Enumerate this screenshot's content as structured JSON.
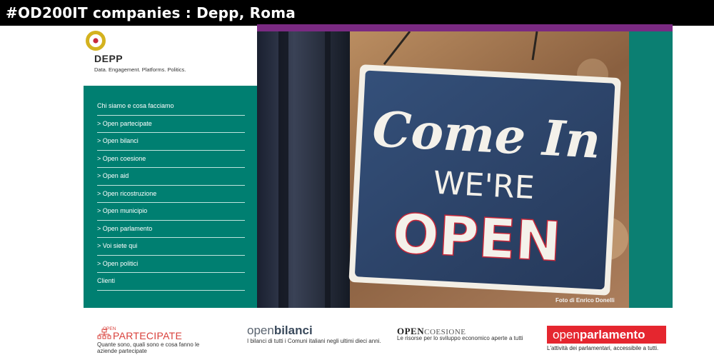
{
  "slide": {
    "title": "#OD200IT companies : Depp, Roma"
  },
  "brand": {
    "name": "DEPP",
    "tagline": "Data. Engagement. Platforms. Politics.",
    "logo_icon": "target-ring-icon",
    "colors": {
      "ring": "#d4b21f",
      "dot": "#c8283a",
      "teal": "#007f71",
      "purple": "#7a2a82"
    }
  },
  "menu": {
    "items": [
      {
        "label": "Chi siamo e cosa facciamo"
      },
      {
        "label": "> Open partecipate"
      },
      {
        "label": "> Open bilanci"
      },
      {
        "label": "> Open coesione"
      },
      {
        "label": "> Open aid"
      },
      {
        "label": "> Open ricostruzione"
      },
      {
        "label": "> Open municipio"
      },
      {
        "label": "> Open parlamento"
      },
      {
        "label": "> Voi siete qui"
      },
      {
        "label": "> Open politici"
      },
      {
        "label": "Clienti"
      }
    ]
  },
  "hero": {
    "sign_line1": "Come In",
    "sign_line2": "WE'RE",
    "sign_line3": "OPEN",
    "photo_credit": "Foto di Enrico Donelli"
  },
  "partners": {
    "openpartecipate": {
      "top": "OPEN",
      "name": "PARTECIPATE",
      "desc": "Quante sono, quali sono e cosa fanno le aziende partecipate"
    },
    "openbilanci": {
      "name_light": "open",
      "name_bold": "bilanci",
      "desc": "I bilanci di tutti i Comuni italiani negli ultimi dieci anni."
    },
    "opencoesione": {
      "name_a": "OPEN",
      "name_b": "COESIONE",
      "desc": "Le risorse per lo sviluppo economico aperte a tutti"
    },
    "openparlamento": {
      "name_light": "open",
      "name_bold": "parlamento",
      "desc": "L'attività dei parlamentari, accessibile a tutti."
    }
  }
}
